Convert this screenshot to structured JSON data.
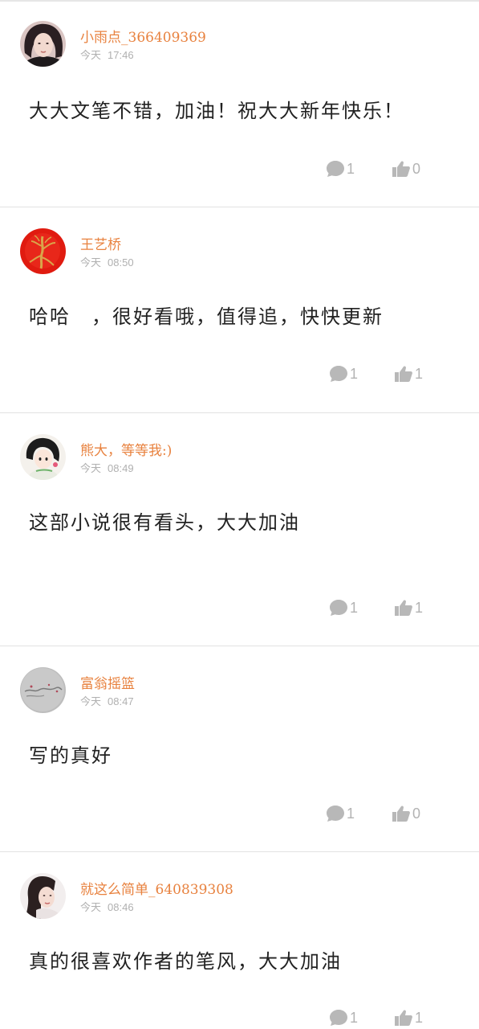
{
  "comments": [
    {
      "username": "小雨点_366409369",
      "day": "今天",
      "time": "17:46",
      "text": "大大文笔不错，加油！祝大大新年快乐！",
      "reply_count": "1",
      "like_count": "0",
      "avatar": "woman-face-dark-hair"
    },
    {
      "username": "王艺桥",
      "day": "今天",
      "time": "08:50",
      "text": "哈哈　，很好看哦，值得追，快快更新",
      "reply_count": "1",
      "like_count": "1",
      "avatar": "red-ginseng-root"
    },
    {
      "username": "熊大，等等我:)",
      "day": "今天",
      "time": "08:49",
      "text": "这部小说很有看头，大大加油",
      "reply_count": "1",
      "like_count": "1",
      "avatar": "anime-girl"
    },
    {
      "username": "富翁摇篮",
      "day": "今天",
      "time": "08:47",
      "text": "写的真好",
      "reply_count": "1",
      "like_count": "0",
      "avatar": "grey-calligraphy"
    },
    {
      "username": "就这么简单_640839308",
      "day": "今天",
      "time": "08:46",
      "text": "真的很喜欢作者的笔风，大大加油",
      "reply_count": "1",
      "like_count": "1",
      "avatar": "woman-long-hair"
    }
  ],
  "colors": {
    "username": "#e8823f",
    "meta": "#b0b0b0",
    "text": "#222222",
    "icon": "#b3b3b3",
    "divider": "#e2e2e2"
  }
}
